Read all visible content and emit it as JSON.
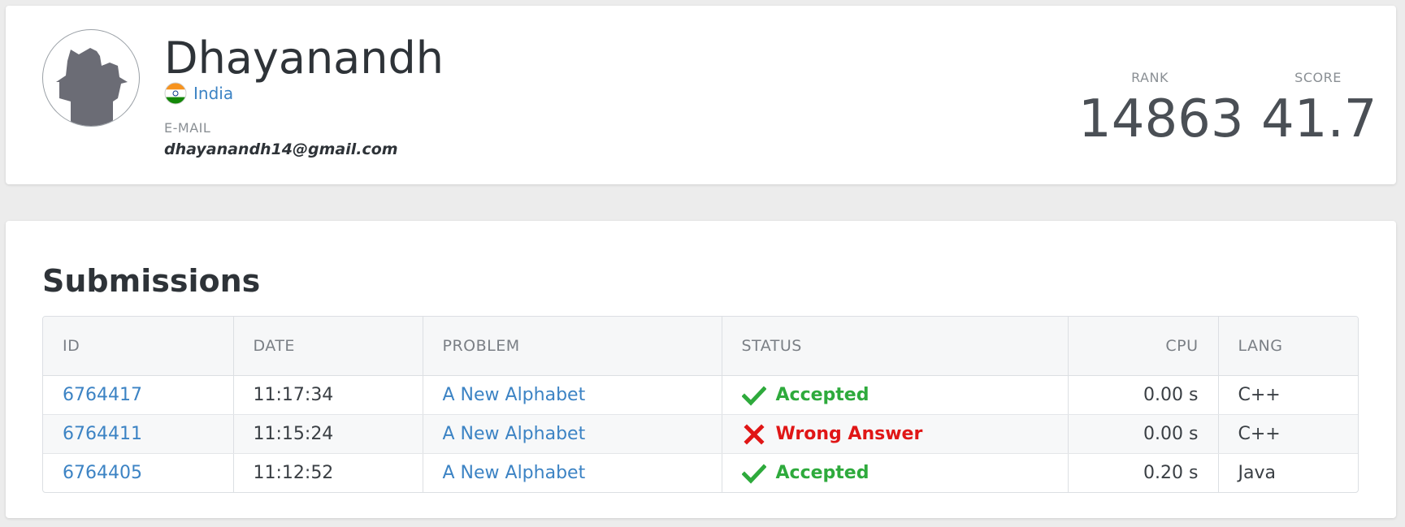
{
  "profile": {
    "name": "Dhayanandh",
    "country": "India",
    "email_label": "E-MAIL",
    "email": "dhayanandh14@gmail.com",
    "rank_label": "RANK",
    "rank": "14863",
    "score_label": "SCORE",
    "score": "41.7"
  },
  "submissions": {
    "title": "Submissions",
    "columns": {
      "id": "ID",
      "date": "DATE",
      "problem": "PROBLEM",
      "status": "STATUS",
      "cpu": "CPU",
      "lang": "LANG"
    },
    "rows": [
      {
        "id": "6764417",
        "date": "11:17:34",
        "problem": "A New Alphabet",
        "status": "Accepted",
        "status_icon": "check-icon",
        "cpu": "0.00 s",
        "lang": "C++"
      },
      {
        "id": "6764411",
        "date": "11:15:24",
        "problem": "A New Alphabet",
        "status": "Wrong Answer",
        "status_icon": "cross-icon",
        "cpu": "0.00 s",
        "lang": "C++"
      },
      {
        "id": "6764405",
        "date": "11:12:52",
        "problem": "A New Alphabet",
        "status": "Accepted",
        "status_icon": "check-icon",
        "cpu": "0.20 s",
        "lang": "Java"
      }
    ]
  },
  "colors": {
    "link": "#3c83c4",
    "accepted": "#2eaa3c",
    "wrong": "#e01616"
  }
}
